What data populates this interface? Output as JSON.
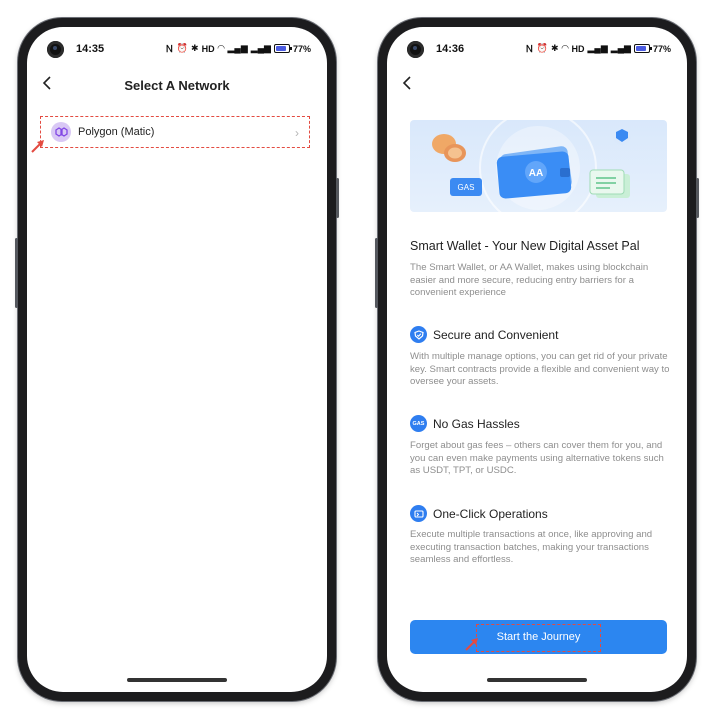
{
  "left_screen": {
    "status": {
      "time": "14:35",
      "battery": "77%"
    },
    "header": {
      "title": "Select A Network"
    },
    "networks": [
      {
        "name": "Polygon (Matic)"
      }
    ]
  },
  "right_screen": {
    "status": {
      "time": "14:36",
      "battery": "77%"
    },
    "banner": {
      "wallet_label": "AA",
      "gas_label": "GAS"
    },
    "heading": "Smart Wallet - Your New Digital Asset Pal",
    "intro": "The Smart Wallet, or AA Wallet, makes using blockchain easier and more secure, reducing entry barriers for a convenient experience",
    "features": [
      {
        "title": "Secure and Convenient",
        "icon": "shield-icon",
        "text": "With multiple manage options, you can get rid of your private key. Smart contracts provide a flexible and convenient way to oversee your assets."
      },
      {
        "title": "No Gas Hassles",
        "icon": "gas-icon",
        "icon_label": "GAS",
        "text": "Forget about gas fees – others can cover them for you, and you can even make payments using alternative tokens such as USDT, TPT, or USDC."
      },
      {
        "title": "One-Click Operations",
        "icon": "batch-icon",
        "text": "Execute multiple transactions at once, like approving and executing transaction batches, making your transactions seamless and effortless."
      }
    ],
    "cta": "Start the Journey"
  },
  "colors": {
    "accent": "#2c86f0",
    "highlight": "#e34b41",
    "polygon": "#8247e5"
  }
}
